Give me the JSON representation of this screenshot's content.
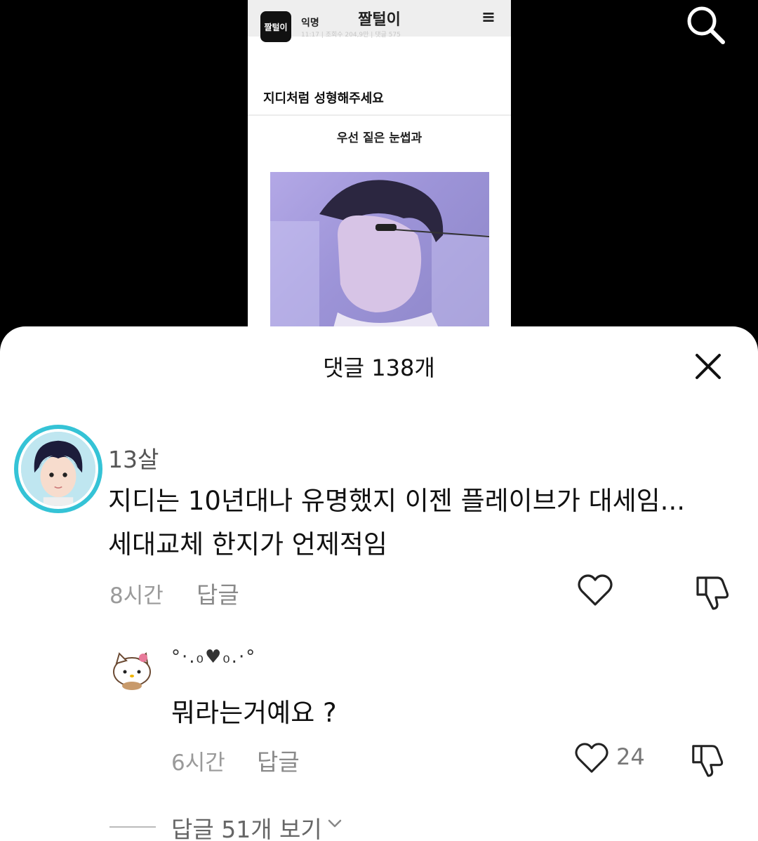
{
  "top": {
    "search_icon": "search-icon"
  },
  "post": {
    "app_name": "짤털이",
    "back_glyph": "‹",
    "menu_glyph": "≡",
    "logo_text": "짤털이",
    "author": "익명",
    "meta": "11:17 | 조회수 204,9만 | 댓글 575",
    "title": "지디처럼 성형해주세요",
    "caption": "우선 짙은 눈썹과"
  },
  "sheet": {
    "title": "댓글 138개",
    "close_icon": "close-icon"
  },
  "comments": [
    {
      "user": "13살",
      "text_line1": "지디는 10년대나 유명했지 이젠 플레이브가 대세임...",
      "text_line2": "세대교체 한지가 언제적임",
      "time": "8시간",
      "reply_label": "답글"
    },
    {
      "user": "°·.₀♥₀.·°",
      "text": "뭐라는거예요 ?",
      "time": "6시간",
      "reply_label": "답글",
      "like_count": "24"
    }
  ],
  "more_replies": {
    "label": "답글 51개 보기"
  },
  "colors": {
    "avatar_ring": "#35c3d6",
    "sheet_bg": "#ffffff",
    "backdrop": "#000000"
  }
}
